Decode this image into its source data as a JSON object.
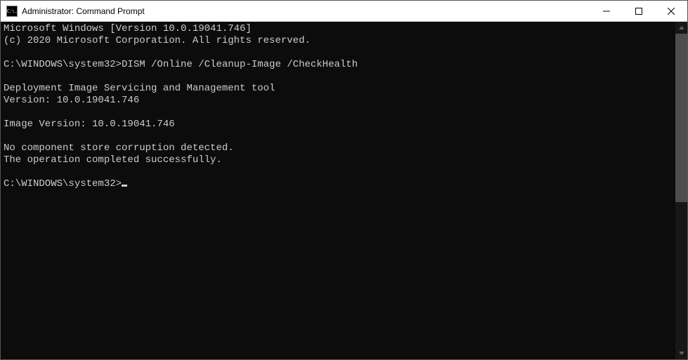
{
  "titlebar": {
    "icon_text": "C:\\.",
    "title": "Administrator: Command Prompt"
  },
  "console": {
    "lines": [
      "Microsoft Windows [Version 10.0.19041.746]",
      "(c) 2020 Microsoft Corporation. All rights reserved.",
      "",
      "C:\\WINDOWS\\system32>DISM /Online /Cleanup-Image /CheckHealth",
      "",
      "Deployment Image Servicing and Management tool",
      "Version: 10.0.19041.746",
      "",
      "Image Version: 10.0.19041.746",
      "",
      "No component store corruption detected.",
      "The operation completed successfully.",
      "",
      "C:\\WINDOWS\\system32>"
    ]
  }
}
